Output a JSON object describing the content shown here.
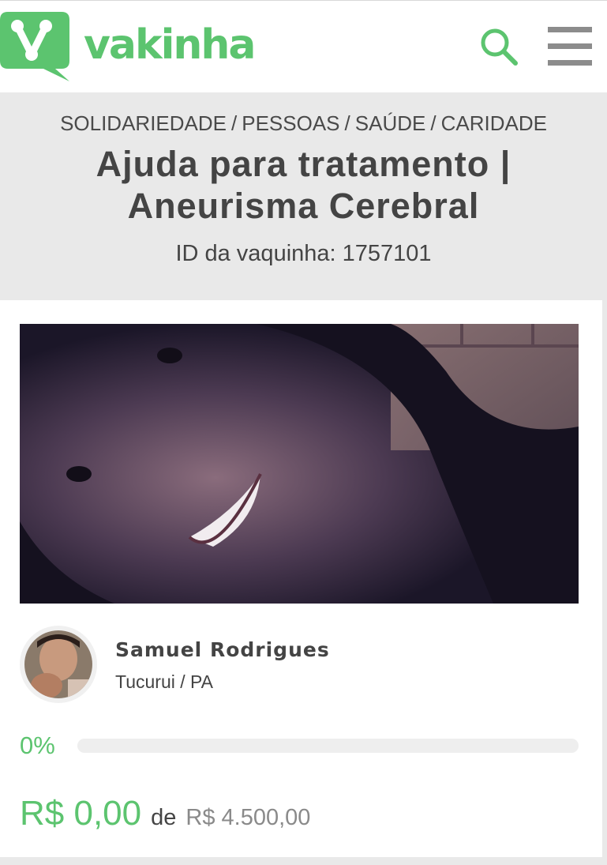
{
  "brand": {
    "name": "vakinha",
    "accent_color": "#5cc46f",
    "logo_icon": "vakinha-logo-icon"
  },
  "header": {
    "search_icon": "search-icon",
    "menu_icon": "hamburger-menu-icon"
  },
  "breadcrumb": [
    "SOLIDARIEDADE",
    "PESSOAS",
    "SAÚDE",
    "CARIDADE"
  ],
  "campaign": {
    "title": "Ajuda para tratamento | Aneurisma Cerebral",
    "id_label": "ID da vaquinha: 1757101"
  },
  "owner": {
    "name": "Samuel Rodrigues",
    "location": "Tucurui / PA"
  },
  "progress": {
    "percent_label": "0%",
    "percent_value": 0
  },
  "amounts": {
    "raised": "R$ 0,00",
    "connector": "de",
    "goal": "R$ 4.500,00"
  }
}
